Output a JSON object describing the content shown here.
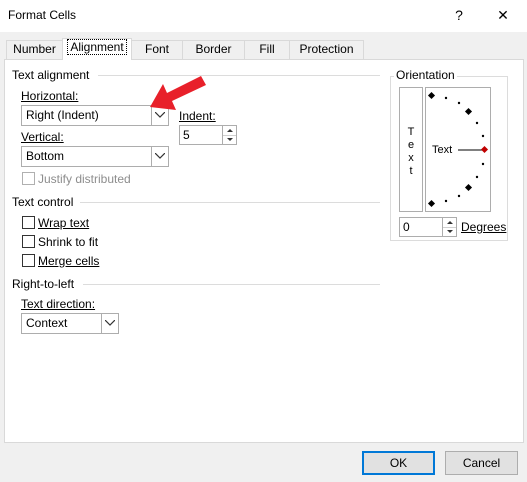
{
  "window": {
    "title": "Format Cells",
    "help_label": "?",
    "close_label": "✕"
  },
  "tabs": [
    {
      "label": "Number",
      "active": false
    },
    {
      "label": "Alignment",
      "active": true
    },
    {
      "label": "Font",
      "active": false
    },
    {
      "label": "Border",
      "active": false
    },
    {
      "label": "Fill",
      "active": false
    },
    {
      "label": "Protection",
      "active": false
    }
  ],
  "text_alignment": {
    "section_label": "Text alignment",
    "horizontal_label": "Horizontal:",
    "horizontal_value": "Right (Indent)",
    "vertical_label": "Vertical:",
    "vertical_value": "Bottom",
    "indent_label": "Indent:",
    "indent_value": "5",
    "justify_distributed_label": "Justify distributed",
    "justify_distributed_checked": false,
    "justify_distributed_enabled": false
  },
  "text_control": {
    "section_label": "Text control",
    "wrap_text_label": "Wrap text",
    "shrink_to_fit_label": "Shrink to fit",
    "merge_cells_label": "Merge cells"
  },
  "right_to_left": {
    "section_label": "Right-to-left",
    "text_direction_label": "Text direction:",
    "text_direction_value": "Context"
  },
  "orientation": {
    "section_label": "Orientation",
    "vertical_text_chars": [
      "T",
      "e",
      "x",
      "t"
    ],
    "dial_text": "Text",
    "degrees_value": "0",
    "degrees_label": "Degrees"
  },
  "footer": {
    "ok_label": "OK",
    "cancel_label": "Cancel"
  },
  "colors": {
    "annotation_arrow": "#e8202a",
    "dial_pointer": "#c00000",
    "default_button_border": "#0078d7"
  }
}
